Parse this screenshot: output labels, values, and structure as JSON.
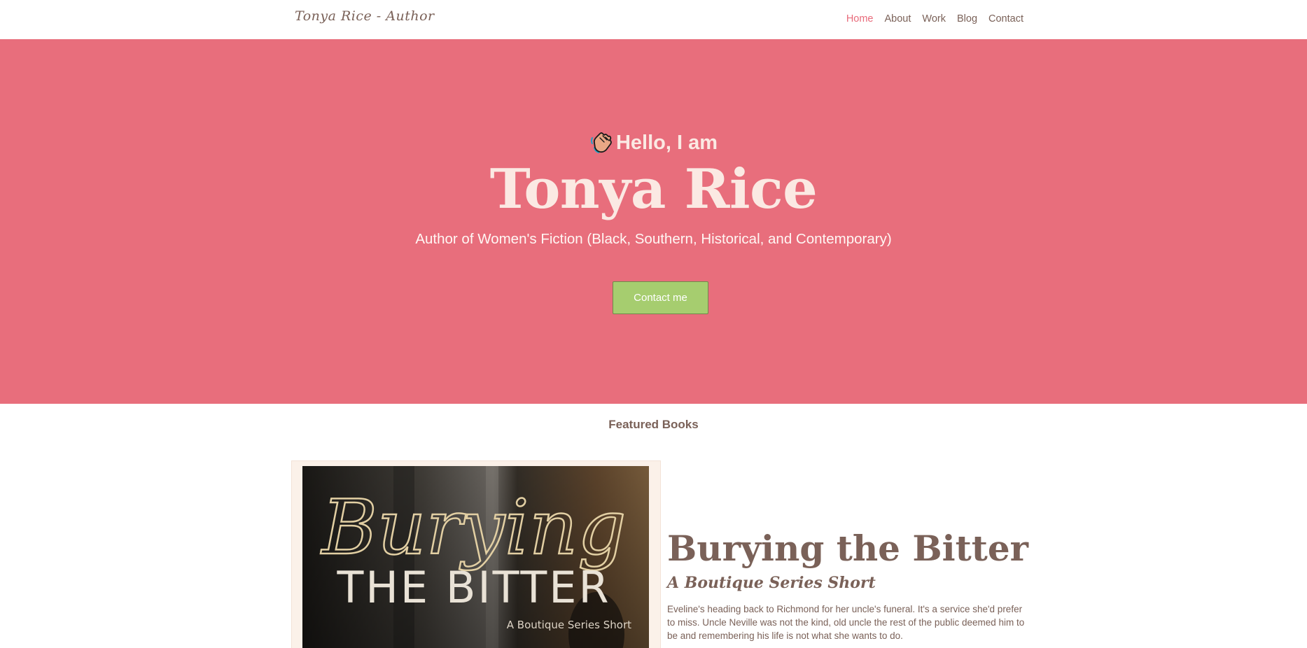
{
  "header": {
    "brand": "Tonya Rice - Author",
    "nav": [
      {
        "label": "Home",
        "active": true
      },
      {
        "label": "About",
        "active": false
      },
      {
        "label": "Work",
        "active": false
      },
      {
        "label": "Blog",
        "active": false
      },
      {
        "label": "Contact",
        "active": false
      }
    ]
  },
  "hero": {
    "greeting": "Hello, I am",
    "greeting_icon": "waving-hand-icon",
    "name": "Tonya Rice",
    "tagline": "Author of Women's Fiction (Black, Southern, Historical, and Contemporary)",
    "cta_label": "Contact me"
  },
  "featured": {
    "heading": "Featured Books",
    "book": {
      "cover_script_title": "Burying",
      "cover_block_title": "THE BITTER",
      "cover_series": "A Boutique Series Short",
      "title": "Burying the Bitter",
      "subtitle": "A Boutique Series Short",
      "description": "Eveline's heading back to Richmond for her uncle's funeral. It's a service she'd prefer to miss. Uncle Neville was not the kind, old uncle the rest of the public deemed him to be and remembering his life is not what she wants to do."
    }
  },
  "colors": {
    "hero_bg": "#e86e7c",
    "hero_text": "#fbe9e3",
    "accent_active": "#e86b7b",
    "button_bg": "#a6cd6f",
    "body_text": "#7a6158",
    "card_bg": "#fbf1e9"
  }
}
